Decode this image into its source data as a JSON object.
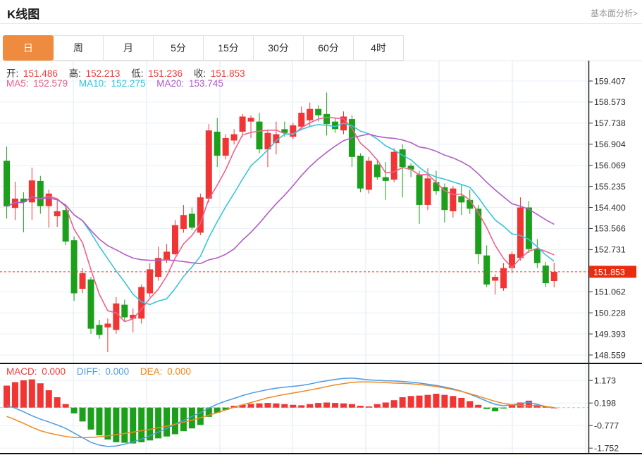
{
  "header": {
    "title": "K线图",
    "link": "基本面分析>"
  },
  "tabs": [
    {
      "label": "日",
      "active": true
    },
    {
      "label": "周",
      "active": false
    },
    {
      "label": "月",
      "active": false
    },
    {
      "label": "5分",
      "active": false
    },
    {
      "label": "15分",
      "active": false
    },
    {
      "label": "30分",
      "active": false
    },
    {
      "label": "60分",
      "active": false
    },
    {
      "label": "4时",
      "active": false
    }
  ],
  "legend": {
    "ohlc": [
      {
        "label": "开:",
        "value": "151.486"
      },
      {
        "label": "高:",
        "value": "152.213"
      },
      {
        "label": "低:",
        "value": "151.236"
      },
      {
        "label": "收:",
        "value": "151.853"
      }
    ],
    "ma": [
      {
        "label": "MA5:",
        "value": "152.579",
        "color": "#ee5c86"
      },
      {
        "label": "MA10:",
        "value": "152.275",
        "color": "#2fc3da"
      },
      {
        "label": "MA20:",
        "value": "153.745",
        "color": "#ae58c6"
      }
    ],
    "macd": [
      {
        "label": "MACD:",
        "value": "0.000",
        "color": "#f23b3b"
      },
      {
        "label": "DIFF:",
        "value": "0.000",
        "color": "#4f9be4"
      },
      {
        "label": "DEA:",
        "value": "0.000",
        "color": "#f0861c"
      }
    ]
  },
  "chart_data": {
    "type": "candlestick+macd",
    "up_color": "#f13535",
    "down_color": "#1ca01c",
    "grid_color": "#e8f0f8",
    "vgrid_color": "#dfeaf5",
    "x_gridlines": [
      104,
      208,
      312,
      415,
      519,
      623,
      727,
      831
    ],
    "candle_columns": [
      "open",
      "high",
      "low",
      "close"
    ],
    "candles": [
      [
        156.25,
        156.81,
        153.96,
        154.44
      ],
      [
        154.38,
        155.42,
        153.9,
        154.75
      ],
      [
        154.75,
        155.0,
        153.42,
        154.61
      ],
      [
        154.6,
        155.98,
        153.9,
        155.47
      ],
      [
        155.45,
        155.65,
        154.15,
        154.45
      ],
      [
        154.45,
        155.1,
        153.6,
        154.95
      ],
      [
        154.05,
        154.66,
        153.63,
        154.25
      ],
      [
        154.3,
        154.45,
        152.9,
        153.05
      ],
      [
        153.1,
        153.25,
        150.7,
        151.0
      ],
      [
        151.18,
        152.0,
        151.0,
        151.8
      ],
      [
        151.55,
        151.65,
        149.4,
        149.6
      ],
      [
        149.75,
        149.95,
        149.2,
        149.35
      ],
      [
        149.65,
        150.0,
        148.67,
        149.8
      ],
      [
        149.55,
        150.85,
        149.4,
        150.6
      ],
      [
        150.55,
        150.75,
        149.9,
        150.05
      ],
      [
        150.0,
        150.4,
        149.45,
        150.15
      ],
      [
        150.0,
        151.35,
        149.8,
        151.25
      ],
      [
        151.0,
        152.2,
        150.85,
        151.95
      ],
      [
        151.65,
        152.85,
        151.5,
        152.4
      ],
      [
        152.3,
        152.95,
        152.2,
        152.65
      ],
      [
        152.55,
        153.9,
        152.5,
        153.7
      ],
      [
        153.55,
        154.5,
        153.4,
        154.1
      ],
      [
        154.15,
        154.4,
        153.5,
        153.6
      ],
      [
        153.4,
        154.95,
        153.3,
        154.8
      ],
      [
        154.75,
        157.7,
        154.6,
        157.45
      ],
      [
        157.4,
        157.95,
        156.0,
        156.45
      ],
      [
        156.45,
        157.3,
        156.3,
        157.15
      ],
      [
        157.05,
        157.5,
        156.9,
        157.3
      ],
      [
        157.4,
        158.1,
        157.2,
        158.0
      ],
      [
        157.8,
        158.05,
        157.15,
        157.95
      ],
      [
        157.8,
        158.15,
        156.55,
        156.7
      ],
      [
        156.7,
        157.45,
        156.0,
        157.35
      ],
      [
        156.95,
        157.8,
        156.5,
        157.3
      ],
      [
        157.5,
        157.8,
        157.2,
        157.35
      ],
      [
        157.2,
        157.75,
        157.1,
        157.65
      ],
      [
        157.6,
        158.4,
        157.45,
        158.15
      ],
      [
        157.85,
        158.55,
        157.6,
        158.3
      ],
      [
        158.3,
        158.45,
        157.8,
        158.05
      ],
      [
        158.1,
        158.95,
        157.25,
        157.7
      ],
      [
        157.8,
        157.95,
        157.35,
        157.5
      ],
      [
        157.45,
        158.2,
        157.3,
        158.0
      ],
      [
        157.9,
        158.05,
        156.0,
        156.4
      ],
      [
        156.45,
        156.55,
        155.0,
        155.15
      ],
      [
        155.1,
        156.4,
        154.95,
        156.25
      ],
      [
        156.1,
        156.3,
        155.5,
        155.6
      ],
      [
        155.6,
        156.2,
        154.7,
        155.45
      ],
      [
        155.5,
        156.75,
        155.4,
        156.6
      ],
      [
        156.7,
        156.9,
        154.8,
        156.0
      ],
      [
        156.05,
        156.15,
        155.6,
        155.9
      ],
      [
        155.7,
        155.85,
        153.75,
        154.5
      ],
      [
        154.5,
        155.95,
        154.3,
        155.55
      ],
      [
        155.4,
        155.85,
        154.9,
        155.05
      ],
      [
        155.2,
        155.35,
        153.8,
        154.3
      ],
      [
        154.25,
        155.25,
        154.0,
        155.15
      ],
      [
        154.85,
        155.3,
        154.1,
        154.6
      ],
      [
        154.7,
        155.1,
        154.15,
        154.35
      ],
      [
        154.35,
        154.5,
        152.15,
        152.55
      ],
      [
        152.5,
        152.9,
        151.25,
        151.35
      ],
      [
        151.5,
        151.75,
        150.95,
        151.65
      ],
      [
        151.2,
        152.2,
        151.1,
        152.0
      ],
      [
        152.0,
        152.65,
        151.8,
        152.55
      ],
      [
        152.4,
        154.8,
        152.3,
        154.4
      ],
      [
        154.4,
        154.65,
        152.6,
        152.75
      ],
      [
        152.75,
        153.15,
        152.0,
        152.2
      ],
      [
        152.1,
        152.25,
        151.25,
        151.4
      ],
      [
        151.486,
        152.213,
        151.236,
        151.853
      ]
    ],
    "ma_lines": [
      {
        "name": "MA5",
        "period": 5,
        "color": "#f2608c"
      },
      {
        "name": "MA10",
        "period": 10,
        "color": "#38c5da"
      },
      {
        "name": "MA20",
        "period": 20,
        "color": "#b45cc6"
      }
    ],
    "price_axis": {
      "ticks": [
        159.407,
        158.573,
        157.738,
        156.904,
        156.069,
        155.235,
        154.4,
        153.566,
        152.731,
        151.062,
        150.228,
        149.393,
        148.559
      ],
      "tick_labels": [
        "159.407",
        "158.573",
        "157.738",
        "156.904",
        "156.069",
        "155.235",
        "154.400",
        "153.566",
        "152.731",
        "151.062",
        "150.228",
        "149.393",
        "148.559"
      ],
      "current_price": 151.853,
      "current_label": "151.853",
      "current_tag_color": "#ea2c0e",
      "current_line_color": "#f5392b"
    },
    "macd": {
      "histogram": [
        0.95,
        1.1,
        1.18,
        1.22,
        1.05,
        0.75,
        0.45,
        0.15,
        -0.25,
        -0.6,
        -0.95,
        -1.2,
        -1.38,
        -1.5,
        -1.52,
        -1.55,
        -1.5,
        -1.42,
        -1.33,
        -1.25,
        -1.15,
        -1.02,
        -0.9,
        -0.75,
        -0.4,
        -0.22,
        -0.1,
        0.08,
        0.12,
        0.16,
        0.18,
        0.2,
        0.18,
        0.15,
        0.12,
        0.1,
        0.15,
        0.2,
        0.22,
        0.2,
        0.18,
        0.15,
        0.08,
        0.05,
        0.15,
        0.22,
        0.32,
        0.45,
        0.5,
        0.52,
        0.55,
        0.6,
        0.55,
        0.5,
        0.42,
        0.28,
        0.12,
        -0.06,
        -0.16,
        -0.04,
        0.1,
        0.22,
        0.3,
        0.12,
        0.04,
        0.0
      ],
      "diff": [
        0.1,
        -0.02,
        -0.18,
        -0.35,
        -0.5,
        -0.62,
        -0.75,
        -0.9,
        -1.1,
        -1.3,
        -1.5,
        -1.62,
        -1.68,
        -1.66,
        -1.58,
        -1.48,
        -1.36,
        -1.22,
        -1.06,
        -0.9,
        -0.72,
        -0.55,
        -0.38,
        -0.22,
        -0.02,
        0.15,
        0.28,
        0.4,
        0.52,
        0.62,
        0.7,
        0.78,
        0.84,
        0.88,
        0.92,
        0.96,
        1.02,
        1.1,
        1.16,
        1.22,
        1.26,
        1.28,
        1.24,
        1.2,
        1.18,
        1.16,
        1.15,
        1.13,
        1.1,
        1.06,
        1.01,
        0.96,
        0.89,
        0.81,
        0.71,
        0.58,
        0.44,
        0.28,
        0.14,
        0.08,
        0.12,
        0.18,
        0.22,
        0.14,
        0.05,
        0.0
      ],
      "dea": [
        -0.38,
        -0.52,
        -0.68,
        -0.85,
        -1.0,
        -1.1,
        -1.18,
        -1.25,
        -1.29,
        -1.3,
        -1.29,
        -1.26,
        -1.22,
        -1.17,
        -1.12,
        -1.06,
        -1.0,
        -0.94,
        -0.87,
        -0.8,
        -0.72,
        -0.63,
        -0.54,
        -0.44,
        -0.33,
        -0.22,
        -0.1,
        0.02,
        0.12,
        0.22,
        0.32,
        0.42,
        0.5,
        0.57,
        0.63,
        0.69,
        0.76,
        0.83,
        0.91,
        0.98,
        1.04,
        1.09,
        1.11,
        1.11,
        1.1,
        1.08,
        1.06,
        1.05,
        1.03,
        1.0,
        0.96,
        0.91,
        0.85,
        0.78,
        0.7,
        0.6,
        0.5,
        0.38,
        0.27,
        0.18,
        0.12,
        0.1,
        0.09,
        0.09,
        0.05,
        0.0
      ],
      "axis_ticks": [
        1.173,
        0.198,
        -0.777,
        -1.752
      ],
      "axis_labels": [
        "1.173",
        "0.198",
        "-0.777",
        "-1.752"
      ],
      "diff_color": "#4f9be0",
      "dea_color": "#f08820",
      "zero_line_color": "#a9d7ef"
    }
  }
}
